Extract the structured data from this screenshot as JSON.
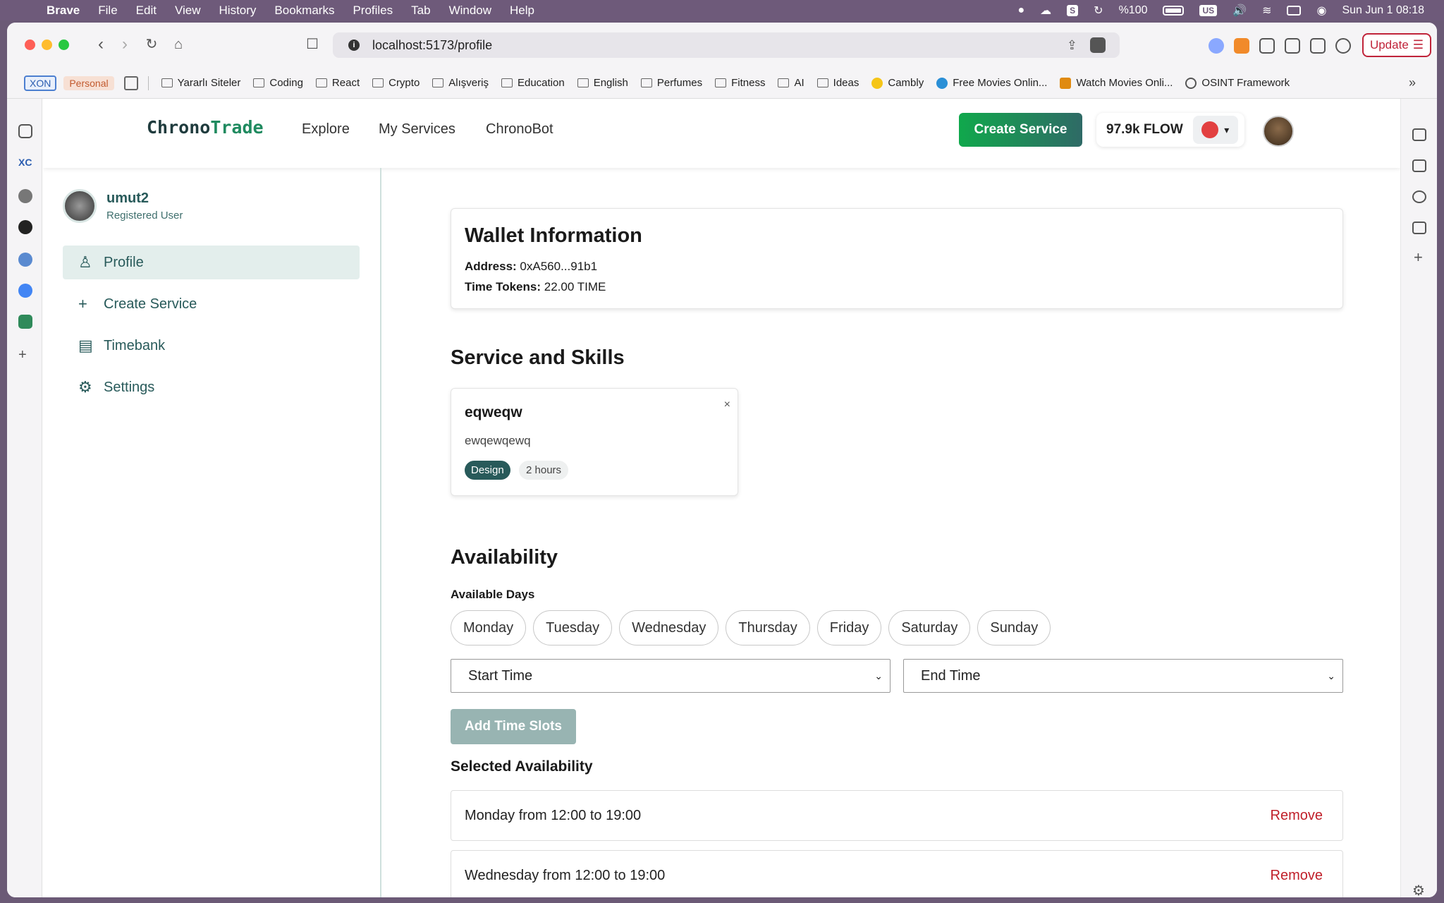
{
  "menubar": {
    "app": "Brave",
    "items": [
      "File",
      "Edit",
      "View",
      "History",
      "Bookmarks",
      "Profiles",
      "Tab",
      "Window",
      "Help"
    ],
    "battery": "%100",
    "input_source": "US",
    "datetime": "Sun Jun 1  08:18"
  },
  "browser": {
    "url": "localhost:5173/profile",
    "update_label": "Update",
    "bookmarks": {
      "xon": "XON",
      "personal": "Personal",
      "items": [
        "Yararlı Siteler",
        "Coding",
        "React",
        "Crypto",
        "Alışveriş",
        "Education",
        "English",
        "Perfumes",
        "Fitness",
        "AI",
        "Ideas",
        "Cambly",
        "Free Movies Onlin...",
        "Watch Movies Onli...",
        "OSINT Framework"
      ],
      "more": "»"
    }
  },
  "header": {
    "logo_part1": "Chrono",
    "logo_part2": "Trade",
    "nav": [
      "Explore",
      "My Services",
      "ChronoBot"
    ],
    "create_button": "Create Service",
    "flow_balance": "97.9k FLOW"
  },
  "sidebar": {
    "username": "umut2",
    "role": "Registered User",
    "items": [
      {
        "label": "Profile",
        "icon": "person-icon",
        "active": true
      },
      {
        "label": "Create Service",
        "icon": "plus-icon",
        "active": false
      },
      {
        "label": "Timebank",
        "icon": "building-icon",
        "active": false
      },
      {
        "label": "Settings",
        "icon": "gear-icon",
        "active": false
      }
    ]
  },
  "wallet": {
    "title": "Wallet Information",
    "address_label": "Address:",
    "address": "0xA560...91b1",
    "tokens_label": "Time Tokens:",
    "tokens": "22.00 TIME"
  },
  "services": {
    "title": "Service and Skills",
    "card": {
      "title": "eqweqw",
      "description": "ewqewqewq",
      "category": "Design",
      "duration": "2 hours",
      "close": "×"
    }
  },
  "availability": {
    "title": "Availability",
    "days_label": "Available Days",
    "days": [
      "Monday",
      "Tuesday",
      "Wednesday",
      "Thursday",
      "Friday",
      "Saturday",
      "Sunday"
    ],
    "start_placeholder": "Start Time",
    "end_placeholder": "End Time",
    "add_button": "Add Time Slots",
    "selected_title": "Selected Availability",
    "selected": [
      {
        "text": "Monday from 12:00 to 19:00",
        "action": "Remove"
      },
      {
        "text": "Wednesday from 12:00 to 19:00",
        "action": "Remove"
      }
    ]
  },
  "colors": {
    "brand_green": "#10a84c",
    "teal": "#285a5a",
    "remove_red": "#c0202a"
  }
}
